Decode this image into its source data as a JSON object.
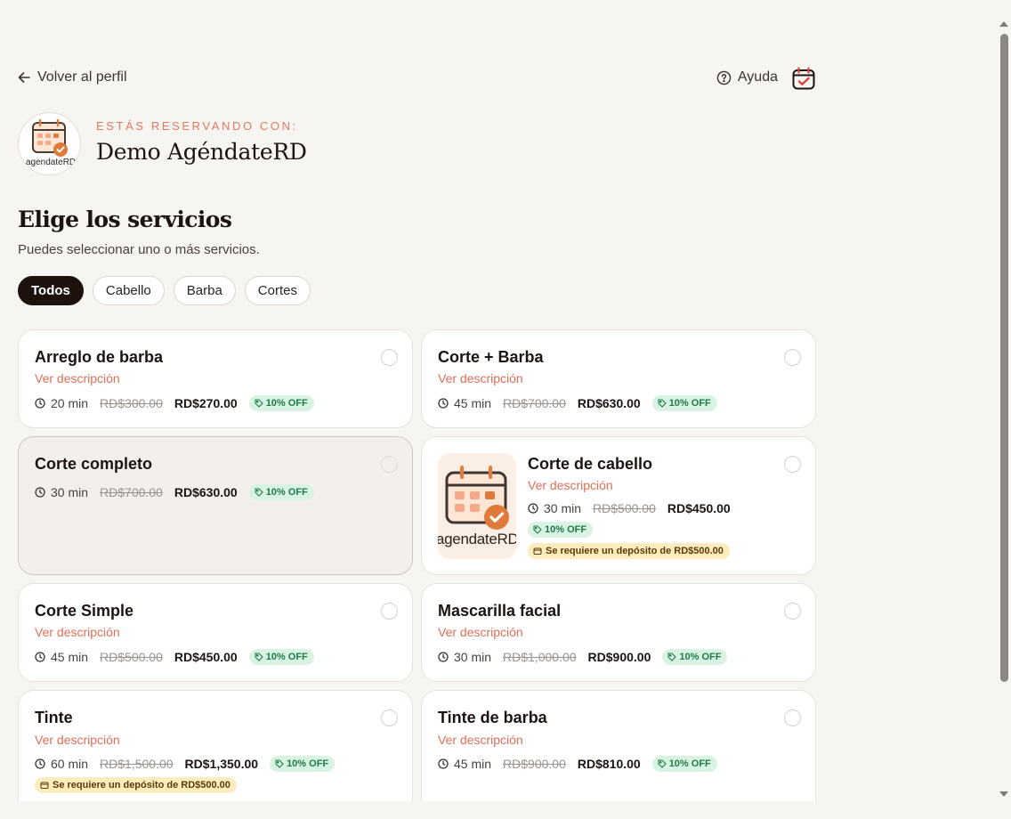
{
  "nav": {
    "back_label": "Volver al perfil",
    "help_label": "Ayuda"
  },
  "business": {
    "kicker": "ESTÁS RESERVANDO CON:",
    "name": "Demo AgéndateRD",
    "logo_text": "agendateRD"
  },
  "heading": {
    "title": "Elige los servicios",
    "subtitle": "Puedes seleccionar uno o más servicios."
  },
  "filters": [
    "Todos",
    "Cabello",
    "Barba",
    "Cortes"
  ],
  "active_filter": "Todos",
  "colors": {
    "accent": "#e07a5f",
    "dark": "#1e120c",
    "discount_bg": "#d9f3e3",
    "discount_text": "#1f7a49",
    "deposit_bg": "#fdecbd"
  },
  "services": [
    {
      "title": "Arreglo de barba",
      "desc": "Ver descripción",
      "duration": "20 min",
      "old_price": "RD$300.00",
      "price": "RD$270.00",
      "discount": "10% OFF"
    },
    {
      "title": "Corte + Barba",
      "desc": "Ver descripción",
      "duration": "45 min",
      "old_price": "RD$700.00",
      "price": "RD$630.00",
      "discount": "10% OFF"
    },
    {
      "title": "Corte completo",
      "duration": "30 min",
      "old_price": "RD$700.00",
      "price": "RD$630.00",
      "discount": "10% OFF"
    },
    {
      "title": "Corte de cabello",
      "desc": "Ver descripción",
      "duration": "30 min",
      "old_price": "RD$500.00",
      "price": "RD$450.00",
      "discount": "10% OFF",
      "deposit": "Se requiere un depósito de RD$500.00",
      "thumb_text": "agendateRD"
    },
    {
      "title": "Corte Simple",
      "desc": "Ver descripción",
      "duration": "45 min",
      "old_price": "RD$500.00",
      "price": "RD$450.00",
      "discount": "10% OFF"
    },
    {
      "title": "Mascarilla facial",
      "desc": "Ver descripción",
      "duration": "30 min",
      "old_price": "RD$1,000.00",
      "price": "RD$900.00",
      "discount": "10% OFF"
    },
    {
      "title": "Tinte",
      "desc": "Ver descripción",
      "duration": "60 min",
      "old_price": "RD$1,500.00",
      "price": "RD$1,350.00",
      "discount": "10% OFF",
      "deposit": "Se requiere un depósito de RD$500.00"
    },
    {
      "title": "Tinte de barba",
      "desc": "Ver descripción",
      "duration": "45 min",
      "old_price": "RD$900.00",
      "price": "RD$810.00",
      "discount": "10% OFF"
    }
  ]
}
